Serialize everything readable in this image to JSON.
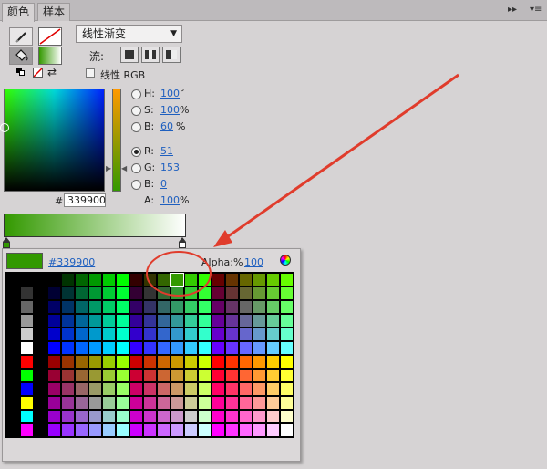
{
  "tabs": [
    {
      "label": "颜色"
    },
    {
      "label": "样本"
    }
  ],
  "header": {
    "collapse_icon": "double-chevron-right-icon",
    "menu_icon": "panel-menu-icon"
  },
  "fill": {
    "type_value": "线性渐变",
    "flow_label": "流:",
    "linear_rgb_label": "线性 RGB",
    "stroke_color": "#ff0000",
    "fill_color": "#339900"
  },
  "hsb": {
    "h_label": "H:",
    "h_value": "100",
    "h_unit": "°",
    "s_label": "S:",
    "s_value": "100",
    "s_unit": "%",
    "b_label": "B:",
    "b_value": "60",
    "b_unit": "%"
  },
  "rgb": {
    "r_label": "R:",
    "r_value": "51",
    "g_label": "G:",
    "g_value": "153",
    "b_label": "B:",
    "b_value": "0"
  },
  "alpha": {
    "label": "A:",
    "value": "100",
    "unit": "%"
  },
  "hex": {
    "label": "#",
    "value": "339900"
  },
  "swatch_popup": {
    "hex_value": "#339900",
    "alpha_label": "Alpha:%",
    "alpha_value": "100"
  },
  "colors": {
    "current": "#339900",
    "selected_swatch": "#339900",
    "annotation_red": "#e03c2c"
  }
}
